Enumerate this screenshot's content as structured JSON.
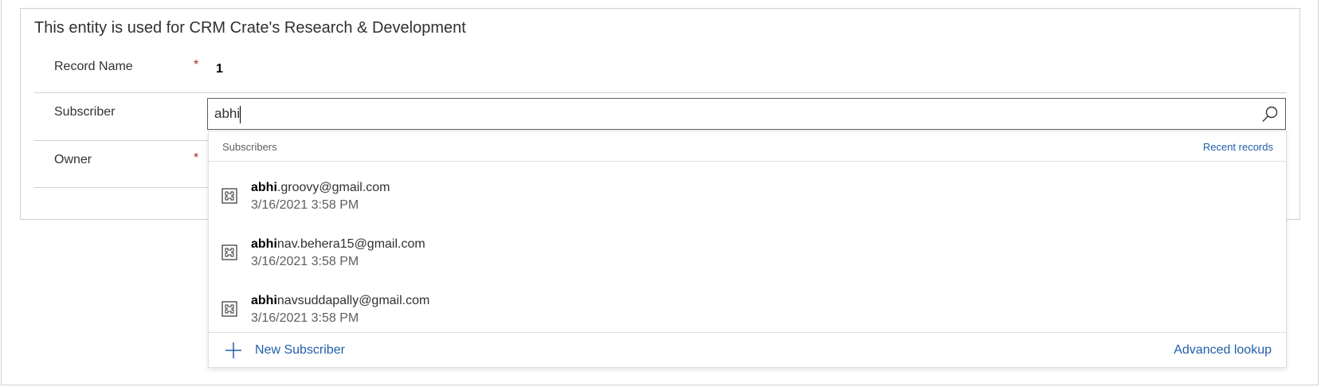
{
  "section": {
    "description": "This entity is used for CRM Crate's Research & Development"
  },
  "fields": {
    "record_name": {
      "label": "Record Name",
      "required_mark": "*",
      "value": "1"
    },
    "subscriber": {
      "label": "Subscriber",
      "input_value": "abhi"
    },
    "owner": {
      "label": "Owner",
      "required_mark": "*"
    }
  },
  "dropdown": {
    "title": "Subscribers",
    "recent_link": "Recent records",
    "items": [
      {
        "match": "abhi",
        "rest": ".groovy@gmail.com",
        "secondary": "3/16/2021 3:58 PM"
      },
      {
        "match": "abhi",
        "rest": "nav.behera15@gmail.com",
        "secondary": "3/16/2021 3:58 PM"
      },
      {
        "match": "abhi",
        "rest": "navsuddapally@gmail.com",
        "secondary": "3/16/2021 3:58 PM"
      }
    ],
    "new_label": "New Subscriber",
    "advanced_lookup": "Advanced lookup"
  },
  "colors": {
    "link": "#1f5ea8",
    "required": "#a4262c",
    "border": "#d2d0ce"
  },
  "icons": {
    "search": "search-icon",
    "entity": "entity-icon",
    "add": "plus-icon"
  }
}
